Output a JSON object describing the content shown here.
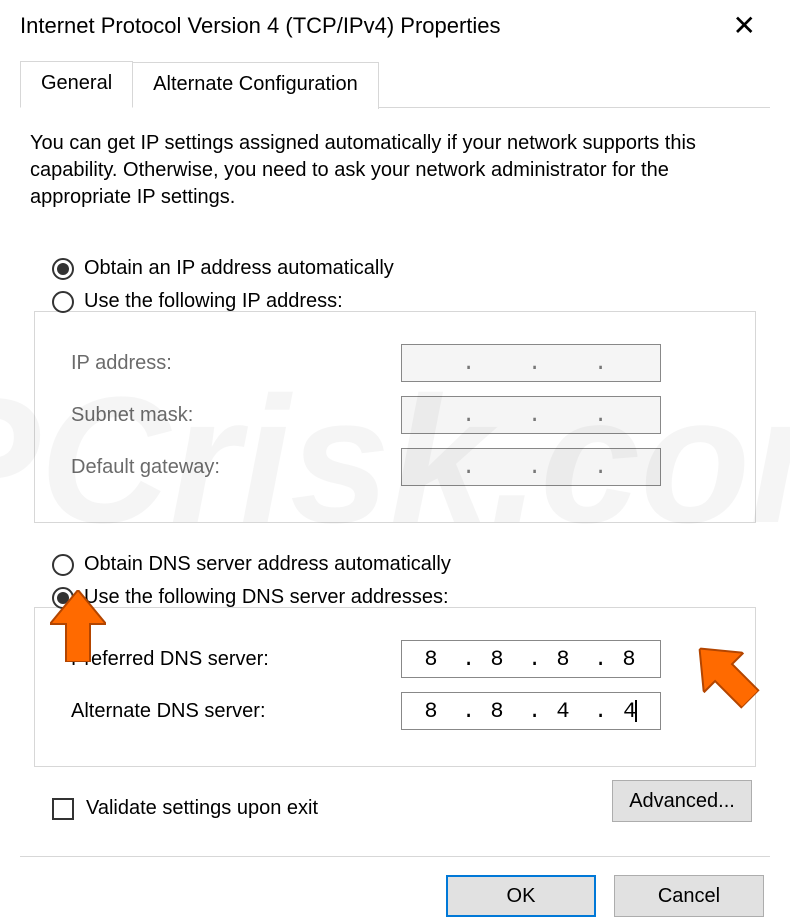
{
  "window": {
    "title": "Internet Protocol Version 4 (TCP/IPv4) Properties"
  },
  "tabs": {
    "general": "General",
    "alternate": "Alternate Configuration"
  },
  "description": "You can get IP settings assigned automatically if your network supports this capability. Otherwise, you need to ask your network administrator for the appropriate IP settings.",
  "ip_section": {
    "radio_auto": "Obtain an IP address automatically",
    "radio_manual": "Use the following IP address:",
    "radio_selected": "auto",
    "fields": {
      "ip_label": "IP address:",
      "subnet_label": "Subnet mask:",
      "gateway_label": "Default gateway:",
      "ip_value": [
        "",
        "",
        "",
        ""
      ],
      "subnet_value": [
        "",
        "",
        "",
        ""
      ],
      "gateway_value": [
        "",
        "",
        "",
        ""
      ]
    }
  },
  "dns_section": {
    "radio_auto": "Obtain DNS server address automatically",
    "radio_manual": "Use the following DNS server addresses:",
    "radio_selected": "manual",
    "fields": {
      "preferred_label": "Preferred DNS server:",
      "alternate_label": "Alternate DNS server:",
      "preferred_value": [
        "8",
        "8",
        "8",
        "8"
      ],
      "alternate_value": [
        "8",
        "8",
        "4",
        "4"
      ]
    }
  },
  "validate_label": "Validate settings upon exit",
  "validate_checked": false,
  "buttons": {
    "advanced": "Advanced...",
    "ok": "OK",
    "cancel": "Cancel"
  },
  "watermark": "PCrisk.com"
}
